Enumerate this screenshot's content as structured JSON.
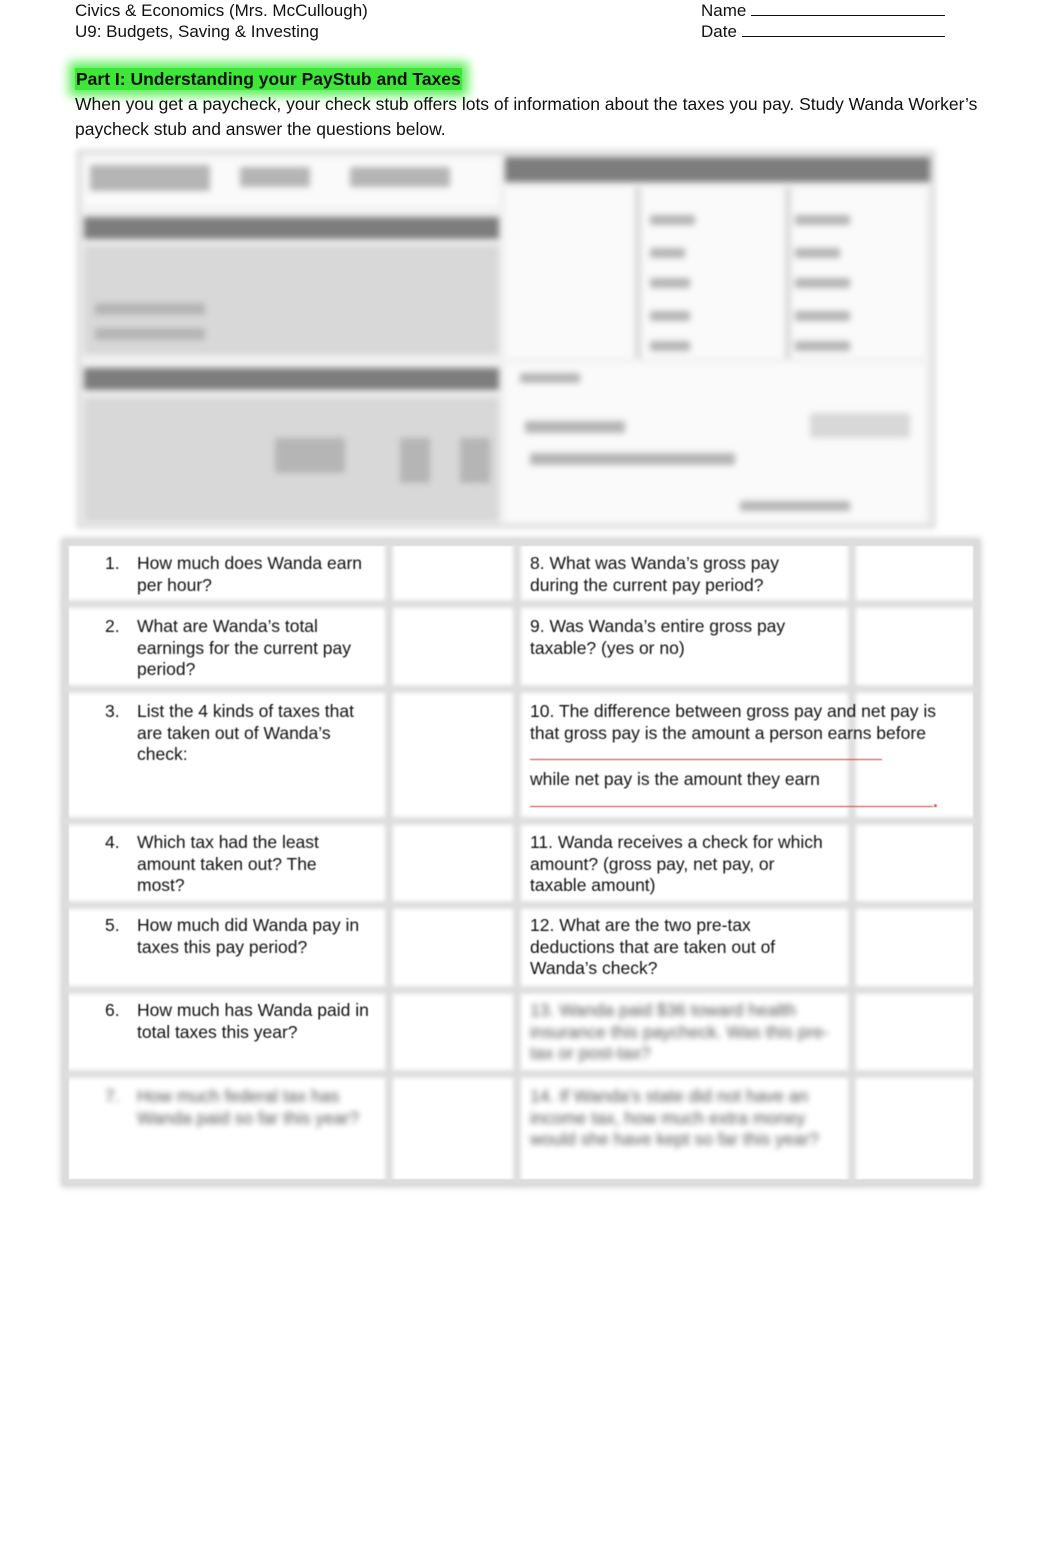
{
  "header": {
    "course": "Civics & Economics (Mrs. McCullough)",
    "unit": "U9: Budgets, Saving & Investing",
    "name_label": "Name",
    "date_label": "Date"
  },
  "part": {
    "title": "Part I: Understanding your PayStub and Taxes",
    "highlight_color": "#3ee63a",
    "intro": "When you get a paycheck, your check stub offers lots of information about the taxes you pay. Study Wanda Worker’s paycheck stub and answer the questions below."
  },
  "paystub": {
    "description": "Blurred image of Wanda Worker's paycheck stub (text illegible)"
  },
  "questions_left": [
    {
      "num": "1.",
      "text": "How much does Wanda earn per hour?"
    },
    {
      "num": "2.",
      "text": "What are Wanda’s total earnings for the current pay period?"
    },
    {
      "num": "3.",
      "text": "List the 4 kinds of taxes that are taken out of Wanda’s check:"
    },
    {
      "num": "4.",
      "text": "Which tax had the least amount taken out? The most?"
    },
    {
      "num": "5.",
      "text": "How much did Wanda pay in taxes this pay period?"
    },
    {
      "num": "6.",
      "text": "How much has Wanda paid in total taxes this year?"
    },
    {
      "num": "7.",
      "text": "How much federal tax has Wanda paid so far this year?"
    }
  ],
  "questions_right": [
    {
      "text": "8. What was Wanda’s gross pay during the current pay period?"
    },
    {
      "text": "9. Was Wanda’s entire gross pay taxable?  (yes or no)"
    },
    {
      "text_a": "10.  The difference between gross pay and net pay is that gross pay is the amount a person earns before",
      "text_b": "while net pay is the amount they earn",
      "end": "."
    },
    {
      "text": "11. Wanda receives a check for which amount? (gross pay, net pay, or taxable amount)"
    },
    {
      "text": "12. What are the two pre-tax deductions that are taken out of Wanda’s check?"
    },
    {
      "text": "13. Wanda paid $36 toward health insurance this paycheck. Was this pre-tax or post-tax?"
    },
    {
      "text": "14. If Wanda’s state did not have an income tax, how much extra money would she have kept so far this year?"
    }
  ],
  "colors": {
    "blank_line_red": "#e23b3b"
  }
}
